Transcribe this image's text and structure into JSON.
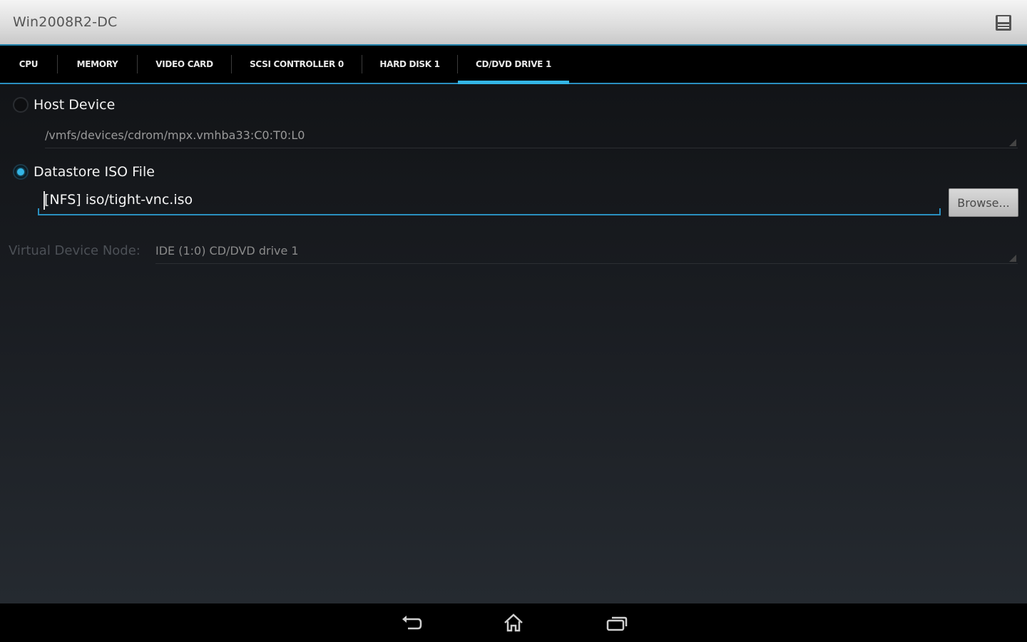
{
  "app": {
    "title": "Win2008R2-DC",
    "save_icon": "save-icon"
  },
  "tabs": [
    {
      "label": "CPU",
      "active": false
    },
    {
      "label": "MEMORY",
      "active": false
    },
    {
      "label": "VIDEO CARD",
      "active": false
    },
    {
      "label": "SCSI CONTROLLER 0",
      "active": false
    },
    {
      "label": "HARD DISK 1",
      "active": false
    },
    {
      "label": "CD/DVD DRIVE 1",
      "active": true
    }
  ],
  "host_device": {
    "label": "Host Device",
    "selected": false,
    "path": "/vmfs/devices/cdrom/mpx.vmhba33:C0:T0:L0"
  },
  "datastore_iso": {
    "label": "Datastore ISO File",
    "selected": true,
    "value": "[NFS] iso/tight-vnc.iso",
    "browse_label": "Browse..."
  },
  "virtual_device_node": {
    "label": "Virtual Device Node:",
    "value": "IDE (1:0) CD/DVD drive 1"
  },
  "colors": {
    "accent": "#33b5e5",
    "title_bar": "#dcdcdc",
    "background": "#15181c"
  },
  "nav": {
    "back_icon": "back-icon",
    "home_icon": "home-icon",
    "recents_icon": "recent-apps-icon"
  }
}
